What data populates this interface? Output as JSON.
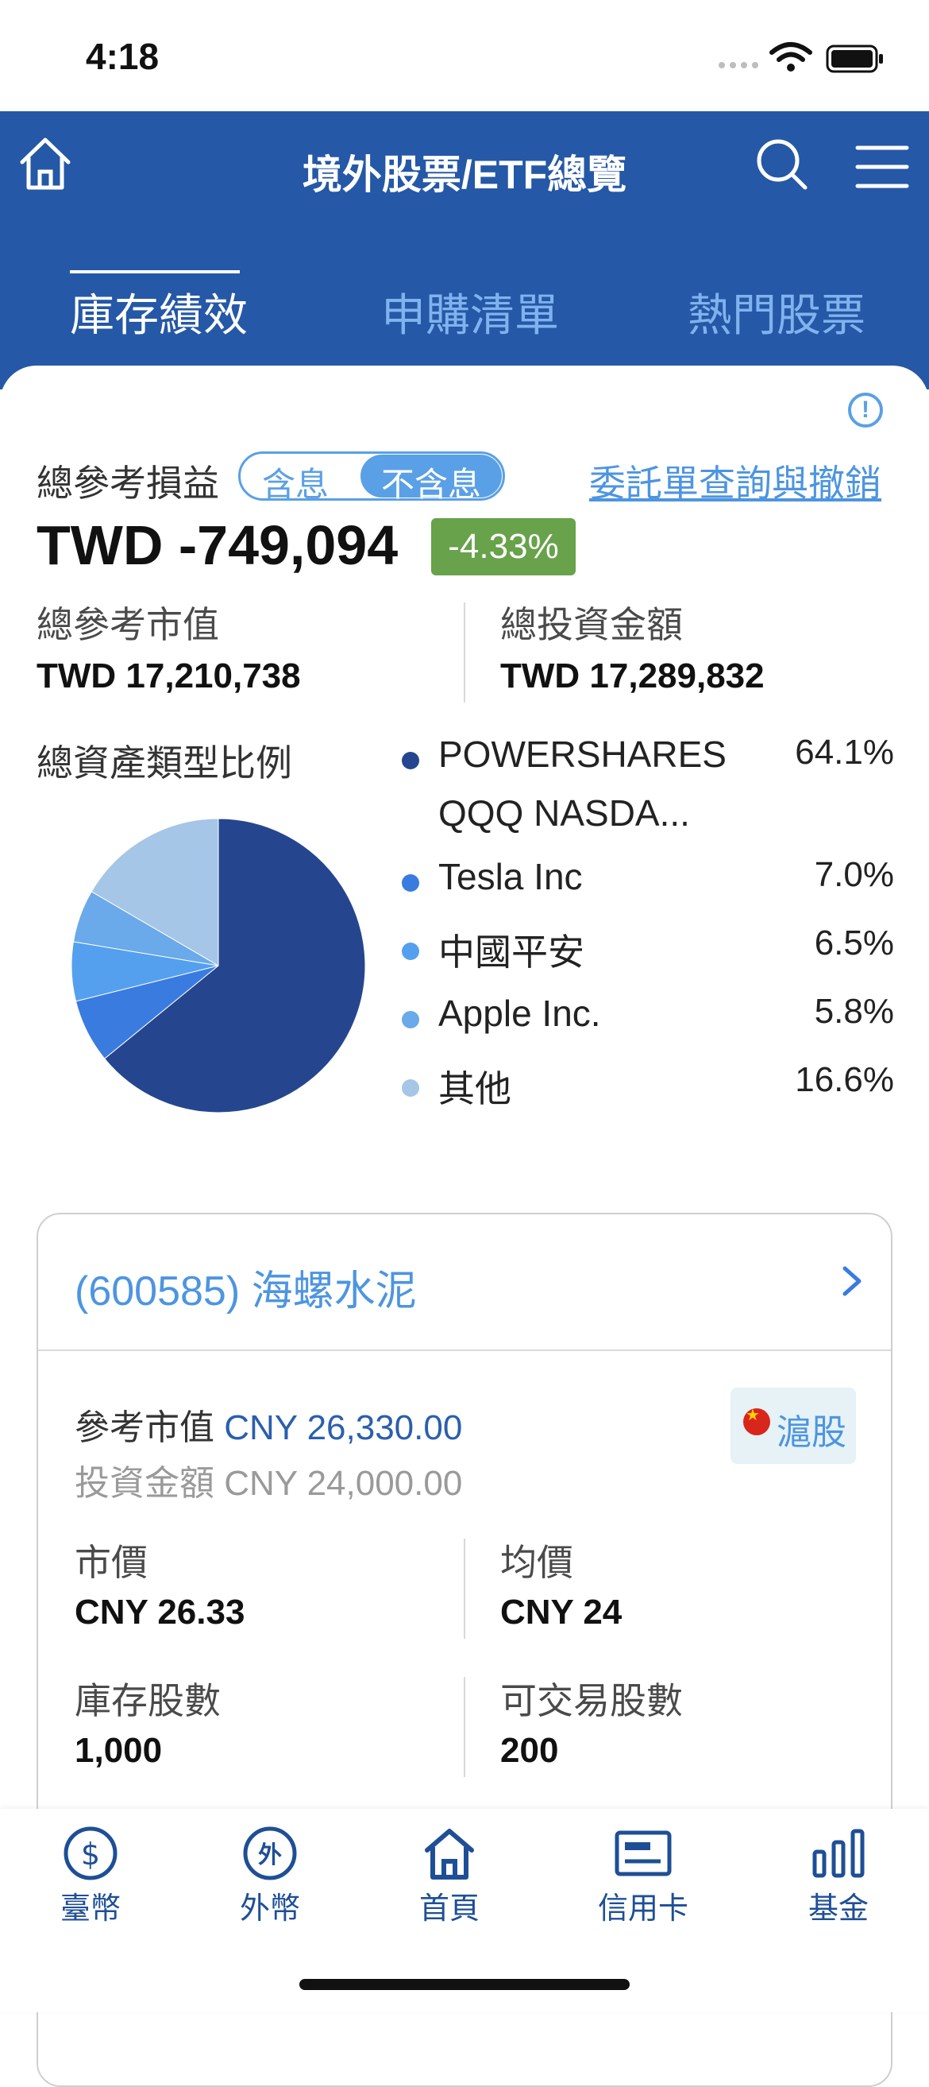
{
  "status_bar": {
    "time": "4:18"
  },
  "header": {
    "title": "境外股票/ETF總覽"
  },
  "tabs": [
    {
      "label": "庫存績效",
      "active": true
    },
    {
      "label": "申購清單",
      "active": false
    },
    {
      "label": "熱門股票",
      "active": false
    }
  ],
  "summary": {
    "pnl_label": "總參考損益",
    "toggle": [
      "含息",
      "不含息"
    ],
    "toggle_selected": "不含息",
    "order_link": "委託單查詢與撤銷",
    "pnl_value": "TWD -749,094",
    "pnl_percent": "-4.33%",
    "market_value_label": "總參考市值",
    "market_value": "TWD 17,210,738",
    "invest_label": "總投資金額",
    "invest_value": "TWD 17,289,832"
  },
  "allocation": {
    "title": "總資產類型比例",
    "items": [
      {
        "name": "POWERSHARES",
        "name_line2": "QQQ NASDA...",
        "percent": "64.1%",
        "color": "#25468f"
      },
      {
        "name": "Tesla Inc",
        "percent": "7.0%",
        "color": "#3a7be0"
      },
      {
        "name": "中國平安",
        "percent": "6.5%",
        "color": "#54a0ee"
      },
      {
        "name": "Apple Inc.",
        "percent": "5.8%",
        "color": "#6aa9ea"
      },
      {
        "name": "其他",
        "percent": "16.6%",
        "color": "#a5c6e6"
      }
    ]
  },
  "chart_data": {
    "type": "pie",
    "categories": [
      "POWERSHARES QQQ NASDA...",
      "Tesla Inc",
      "中國平安",
      "Apple Inc.",
      "其他"
    ],
    "values": [
      64.1,
      7.0,
      6.5,
      5.8,
      16.6
    ],
    "colors": [
      "#25468f",
      "#3a7be0",
      "#54a0ee",
      "#6aa9ea",
      "#a5c6e6"
    ],
    "title": "總資產類型比例"
  },
  "holding": {
    "title": "(600585) 海螺水泥",
    "ref_mv_label": "參考市值",
    "ref_mv_value": "CNY 26,330.00",
    "invest_label": "投資金額",
    "invest_value": "CNY 24,000.00",
    "market": "滬股",
    "price_label": "市價",
    "price_value": "CNY 26.33",
    "avg_label": "均價",
    "avg_value": "CNY 24",
    "stock_qty_label": "庫存股數",
    "stock_qty_value": "1,000",
    "tradable_label": "可交易股數",
    "tradable_value": "200"
  },
  "bottom_nav": [
    {
      "label": "臺幣",
      "icon": "dollar-icon"
    },
    {
      "label": "外幣",
      "icon": "foreign-currency-icon"
    },
    {
      "label": "首頁",
      "icon": "home-icon"
    },
    {
      "label": "信用卡",
      "icon": "credit-card-icon"
    },
    {
      "label": "基金",
      "icon": "bar-chart-icon"
    }
  ]
}
